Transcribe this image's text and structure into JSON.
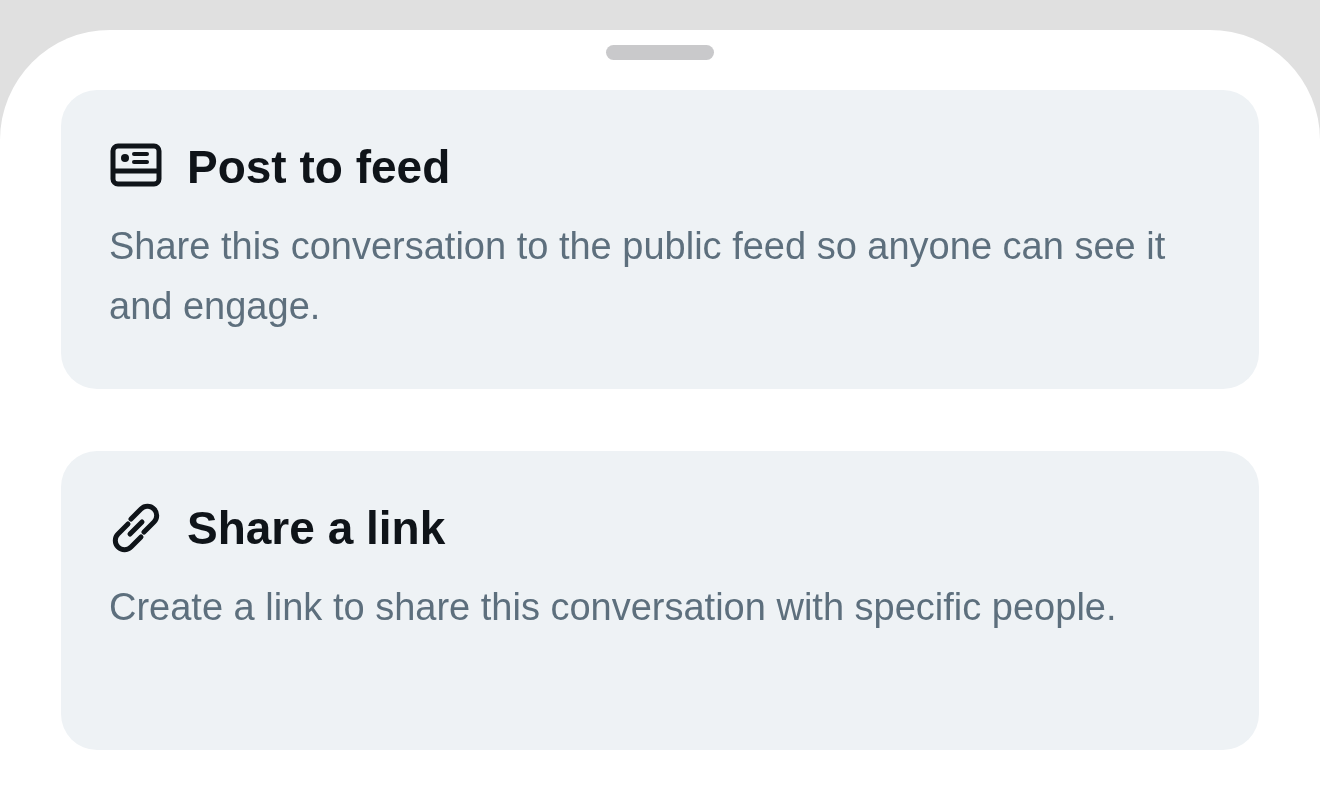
{
  "options": [
    {
      "kind": "feed",
      "title": "Post to feed",
      "description": "Share this conversation to the public feed so anyone can see it and engage."
    },
    {
      "kind": "link",
      "title": "Share a link",
      "description": "Create a link to share this conversation with specific people."
    }
  ]
}
